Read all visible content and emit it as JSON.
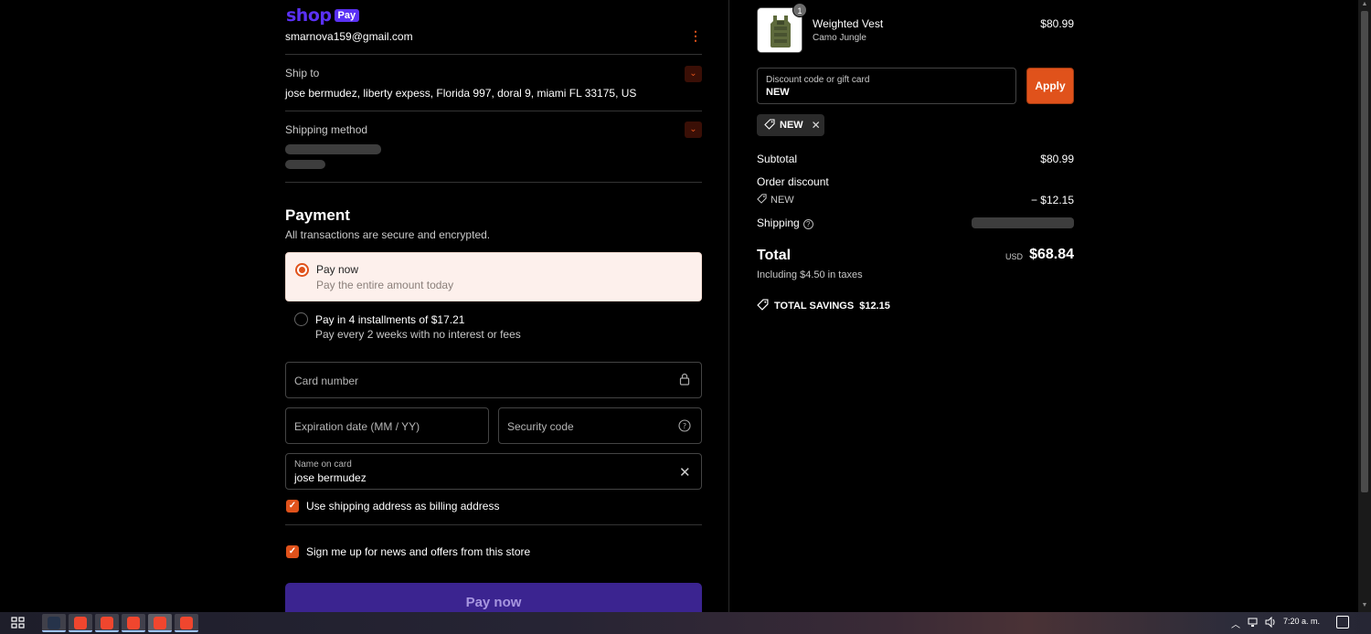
{
  "header": {
    "shop_word": "shop",
    "pay_word": "Pay",
    "email": "smarnova159@gmail.com"
  },
  "ship_to": {
    "label": "Ship to",
    "address": "jose bermudez, liberty expess, Florida 997, doral 9, miami FL 33175, US"
  },
  "shipping_method": {
    "label": "Shipping method"
  },
  "payment": {
    "title": "Payment",
    "subtitle": "All transactions are secure and encrypted.",
    "options": [
      {
        "title": "Pay now",
        "desc": "Pay the entire amount today",
        "selected": true
      },
      {
        "title": "Pay in 4 installments of $17.21",
        "desc": "Pay every 2 weeks with no interest or fees",
        "selected": false
      }
    ],
    "card_number_placeholder": "Card number",
    "expiry_placeholder": "Expiration date (MM / YY)",
    "security_placeholder": "Security code",
    "name_label": "Name on card",
    "name_value": "jose bermudez",
    "billing_checkbox": "Use shipping address as billing address",
    "news_checkbox": "Sign me up for news and offers from this store",
    "pay_button": "Pay now"
  },
  "order": {
    "product": {
      "name": "Weighted Vest",
      "variant": "Camo Jungle",
      "price": "$80.99",
      "quantity": "1"
    },
    "discount_label": "Discount code or gift card",
    "discount_value": "NEW",
    "apply_label": "Apply",
    "applied_tag": "NEW",
    "subtotal_label": "Subtotal",
    "subtotal_value": "$80.99",
    "order_discount_label": "Order discount",
    "discount_code": "NEW",
    "discount_amount": "− $12.15",
    "shipping_label": "Shipping",
    "total_label": "Total",
    "currency": "USD",
    "total_value": "$68.84",
    "tax_note": "Including $4.50 in taxes",
    "savings_label": "TOTAL SAVINGS",
    "savings_value": "$12.15"
  },
  "taskbar": {
    "clock": "7:20 a. m."
  },
  "colors": {
    "accent": "#e0521b",
    "shoppay": "#5a31f4",
    "pay_button": "#3b2490"
  }
}
